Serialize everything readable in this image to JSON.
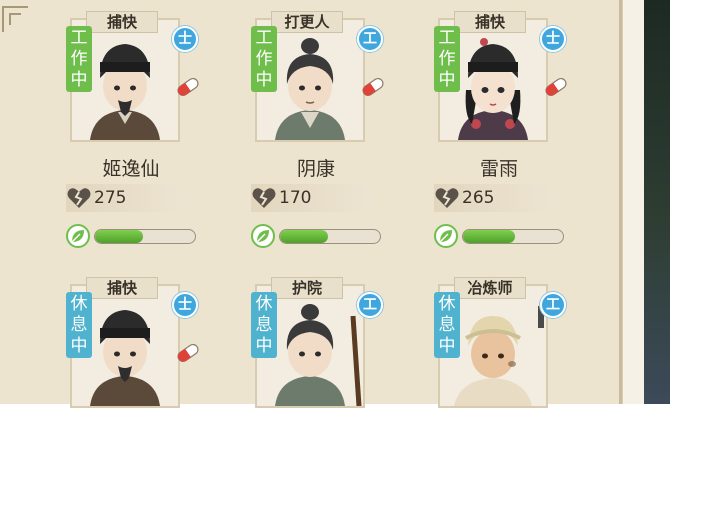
{
  "colors": {
    "work_status": "#6fbe4b",
    "rest_status": "#4fb2cf",
    "rank_badge": "#3fa7dd",
    "bar_fill": "#5cb534"
  },
  "characters": [
    {
      "role": "捕快",
      "status": [
        "工",
        "作",
        "中"
      ],
      "status_type": "work",
      "rank": "士",
      "name": "姬逸仙",
      "stat": "275",
      "bar_fraction": 0.48,
      "icon": "pill-icon",
      "avatar": "constable-hat"
    },
    {
      "role": "打更人",
      "status": [
        "工",
        "作",
        "中"
      ],
      "status_type": "work",
      "rank": "工",
      "name": "阴康",
      "stat": "170",
      "bar_fraction": 0.48,
      "icon": "pill-icon",
      "avatar": "topknot"
    },
    {
      "role": "捕快",
      "status": [
        "工",
        "作",
        "中"
      ],
      "status_type": "work",
      "rank": "士",
      "name": "雷雨",
      "stat": "265",
      "bar_fraction": 0.52,
      "icon": "pill-icon",
      "avatar": "female-hat"
    },
    {
      "role": "捕快",
      "status": [
        "休",
        "息",
        "中"
      ],
      "status_type": "rest",
      "rank": "士",
      "name": "",
      "stat": "",
      "bar_fraction": null,
      "icon": "pill-icon",
      "avatar": "constable-hat"
    },
    {
      "role": "护院",
      "status": [
        "休",
        "息",
        "中"
      ],
      "status_type": "rest",
      "rank": "工",
      "name": "",
      "stat": "",
      "bar_fraction": null,
      "icon": "",
      "avatar": "topknot"
    },
    {
      "role": "冶炼师",
      "status": [
        "休",
        "息",
        "中"
      ],
      "status_type": "rest",
      "rank": "工",
      "name": "",
      "stat": "",
      "bar_fraction": null,
      "icon": "",
      "avatar": "bandana"
    }
  ]
}
